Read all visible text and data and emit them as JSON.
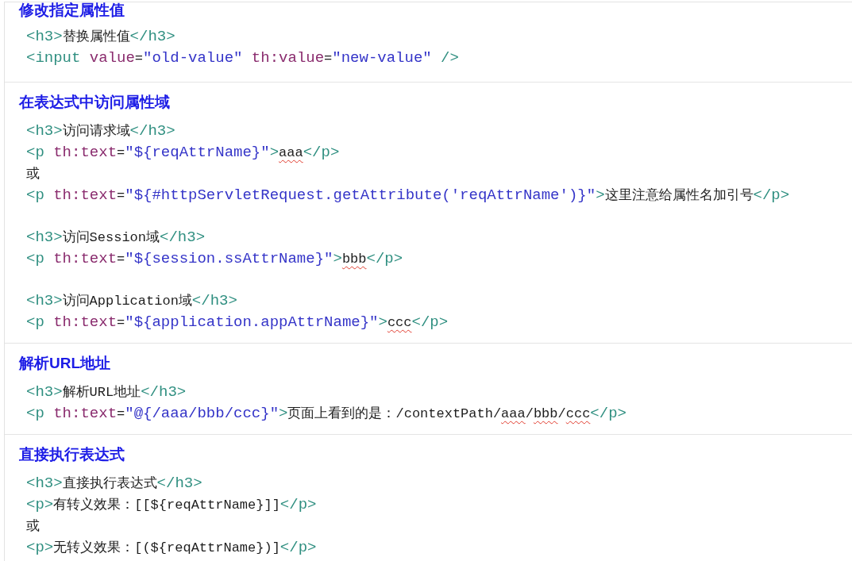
{
  "sections": [
    {
      "heading": "修改指定属性值",
      "blocks": [
        [
          [
            {
              "kind": "tag",
              "text": "<h3>"
            },
            {
              "kind": "text",
              "text": "替换属性值"
            },
            {
              "kind": "tag",
              "text": "</h3>"
            }
          ],
          [
            {
              "kind": "tag",
              "text": "<input"
            },
            {
              "kind": "attr",
              "text": " value"
            },
            {
              "kind": "text",
              "text": "="
            },
            {
              "kind": "string",
              "text": "\"old-value\""
            },
            {
              "kind": "attr",
              "text": " th:value"
            },
            {
              "kind": "text",
              "text": "="
            },
            {
              "kind": "string",
              "text": "\"new-value\""
            },
            {
              "kind": "tag",
              "text": " />"
            }
          ]
        ]
      ]
    },
    {
      "heading": "在表达式中访问属性域",
      "blocks": [
        [
          [
            {
              "kind": "tag",
              "text": "<h3>"
            },
            {
              "kind": "text",
              "text": "访问请求域"
            },
            {
              "kind": "tag",
              "text": "</h3>"
            }
          ],
          [
            {
              "kind": "tag",
              "text": "<p"
            },
            {
              "kind": "attr",
              "text": " th:text"
            },
            {
              "kind": "text",
              "text": "="
            },
            {
              "kind": "string",
              "text": "\"${reqAttrName}\""
            },
            {
              "kind": "tag",
              "text": ">"
            },
            {
              "kind": "text",
              "text": "aaa",
              "misspelled": true
            },
            {
              "kind": "tag",
              "text": "</p>"
            }
          ],
          [
            {
              "kind": "text",
              "text": "或"
            }
          ],
          [
            {
              "kind": "tag",
              "text": "<p"
            },
            {
              "kind": "attr",
              "text": " th:text"
            },
            {
              "kind": "text",
              "text": "="
            },
            {
              "kind": "string",
              "text": "\"${#httpServletRequest.getAttribute('reqAttrName')}\""
            },
            {
              "kind": "tag",
              "text": ">"
            },
            {
              "kind": "text",
              "text": "这里注意给属性名加引号"
            },
            {
              "kind": "tag",
              "text": "</p>"
            }
          ]
        ],
        [
          [
            {
              "kind": "tag",
              "text": "<h3>"
            },
            {
              "kind": "text",
              "text": "访问Session域"
            },
            {
              "kind": "tag",
              "text": "</h3>"
            }
          ],
          [
            {
              "kind": "tag",
              "text": "<p"
            },
            {
              "kind": "attr",
              "text": " th:text"
            },
            {
              "kind": "text",
              "text": "="
            },
            {
              "kind": "string",
              "text": "\"${session.ssAttrName}\""
            },
            {
              "kind": "tag",
              "text": ">"
            },
            {
              "kind": "text",
              "text": "bbb",
              "misspelled": true
            },
            {
              "kind": "tag",
              "text": "</p>"
            }
          ]
        ],
        [
          [
            {
              "kind": "tag",
              "text": "<h3>"
            },
            {
              "kind": "text",
              "text": "访问Application域"
            },
            {
              "kind": "tag",
              "text": "</h3>"
            }
          ],
          [
            {
              "kind": "tag",
              "text": "<p"
            },
            {
              "kind": "attr",
              "text": " th:text"
            },
            {
              "kind": "text",
              "text": "="
            },
            {
              "kind": "string",
              "text": "\"${application.appAttrName}\""
            },
            {
              "kind": "tag",
              "text": ">"
            },
            {
              "kind": "text",
              "text": "ccc",
              "misspelled": true
            },
            {
              "kind": "tag",
              "text": "</p>"
            }
          ]
        ]
      ]
    },
    {
      "heading": "解析URL地址",
      "blocks": [
        [
          [
            {
              "kind": "tag",
              "text": "<h3>"
            },
            {
              "kind": "text",
              "text": "解析URL地址"
            },
            {
              "kind": "tag",
              "text": "</h3>"
            }
          ],
          [
            {
              "kind": "tag",
              "text": "<p"
            },
            {
              "kind": "attr",
              "text": " th:text"
            },
            {
              "kind": "text",
              "text": "="
            },
            {
              "kind": "string",
              "text": "\"@{/aaa/bbb/ccc}\""
            },
            {
              "kind": "tag",
              "text": ">"
            },
            {
              "kind": "text",
              "text": "页面上看到的是：/contextPath/"
            },
            {
              "kind": "text",
              "text": "aaa",
              "misspelled": true
            },
            {
              "kind": "text",
              "text": "/"
            },
            {
              "kind": "text",
              "text": "bbb",
              "misspelled": true
            },
            {
              "kind": "text",
              "text": "/"
            },
            {
              "kind": "text",
              "text": "ccc",
              "misspelled": true
            },
            {
              "kind": "tag",
              "text": "</p>"
            }
          ]
        ]
      ]
    },
    {
      "heading": "直接执行表达式",
      "blocks": [
        [
          [
            {
              "kind": "tag",
              "text": "<h3>"
            },
            {
              "kind": "text",
              "text": "直接执行表达式"
            },
            {
              "kind": "tag",
              "text": "</h3>"
            }
          ],
          [
            {
              "kind": "tag",
              "text": "<p>"
            },
            {
              "kind": "text",
              "text": "有转义效果：[[${reqAttrName}]]"
            },
            {
              "kind": "tag",
              "text": "</p>"
            }
          ],
          [
            {
              "kind": "text",
              "text": "或"
            }
          ],
          [
            {
              "kind": "tag",
              "text": "<p>"
            },
            {
              "kind": "text",
              "text": "无转义效果：[(${reqAttrName})]"
            },
            {
              "kind": "tag",
              "text": "</p>"
            }
          ]
        ]
      ]
    }
  ]
}
